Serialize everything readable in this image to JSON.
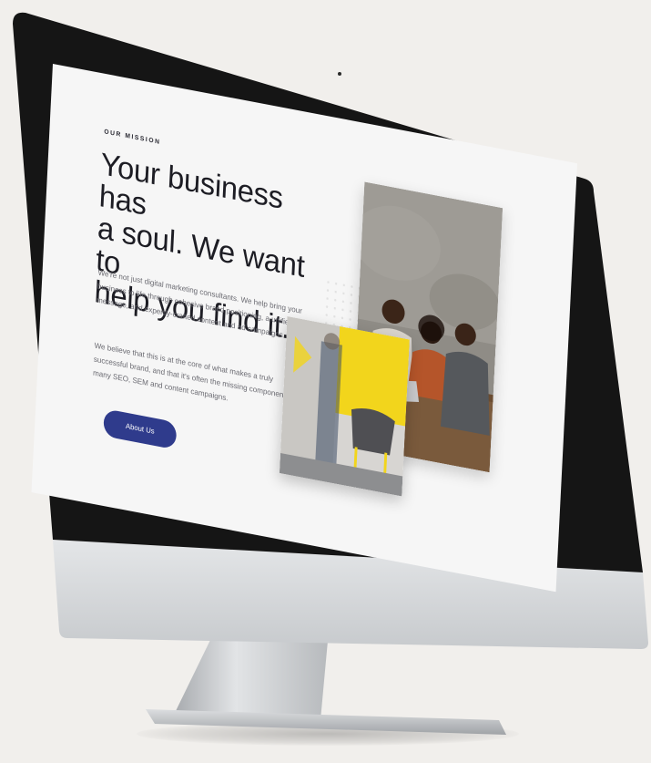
{
  "page": {
    "eyebrow": "OUR MISSION",
    "headline_lines": [
      "Your business has",
      "a soul. We want to",
      "help you find it."
    ],
    "paragraph_1": "We're not just digital marketing consultants. We help bring your business to life through cohesive brand positioning, a unified message, and expertly-crafted content and ad campaigns.",
    "paragraph_2": "We believe that this is at the core of what makes a truly successful brand, and that it's often the missing component in many SEO, SEM and content campaigns.",
    "cta_label": "About Us"
  },
  "images": {
    "team_photo": "team-meeting-photo",
    "office_photo": "office-lounge-photo"
  },
  "colors": {
    "background": "#f1efec",
    "bezel": "#151515",
    "screen": "#f6f6f6",
    "headline": "#1d1d24",
    "body_text": "#6b6b72",
    "button": "#2f3b8c",
    "chin": "#d4d6d8",
    "stand": "#bfc2c5",
    "accent_yellow": "#f2d51c"
  }
}
